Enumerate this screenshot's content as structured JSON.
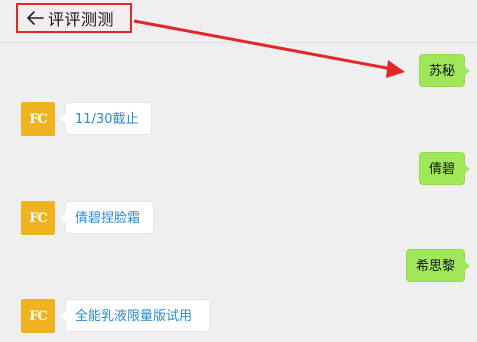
{
  "header": {
    "back_icon": "arrow-left-icon",
    "title": "评评测测"
  },
  "colors": {
    "annotation_red": "#e32626",
    "sent_bubble": "#a0e75a",
    "received_text": "#2a8bd6",
    "avatar_bg": "#efb321"
  },
  "avatar": {
    "initials": "FC"
  },
  "messages": [
    {
      "direction": "sent",
      "text": "苏秘"
    },
    {
      "direction": "received",
      "text": "11/30截止"
    },
    {
      "direction": "sent",
      "text": "倩碧"
    },
    {
      "direction": "received",
      "text": "倩碧捏脸霜"
    },
    {
      "direction": "sent",
      "text": "希思黎"
    },
    {
      "direction": "received",
      "text": "全能乳液限量版试用"
    }
  ]
}
